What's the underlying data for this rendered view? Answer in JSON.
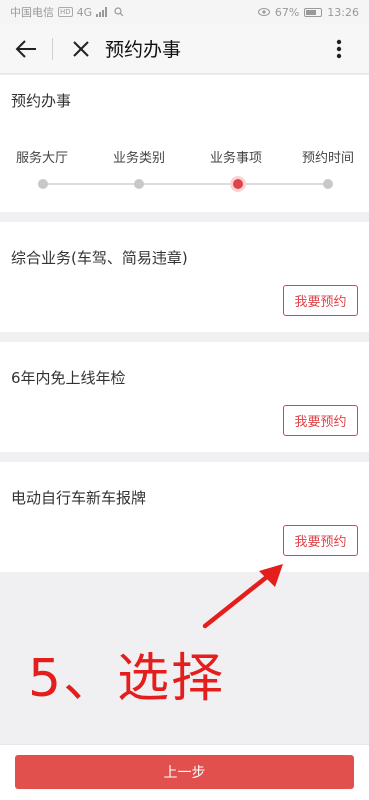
{
  "status_bar": {
    "carrier": "中国电信",
    "hd": "HD",
    "network": "4G",
    "battery": "67%",
    "time": "13:26"
  },
  "nav": {
    "title": "预约办事"
  },
  "steps": {
    "title": "预约办事",
    "items": [
      "服务大厅",
      "业务类别",
      "业务事项",
      "预约时间"
    ],
    "active_index": 2
  },
  "items": [
    {
      "title": "综合业务(车驾、简易违章)",
      "button": "我要预约"
    },
    {
      "title": "6年内免上线年检",
      "button": "我要预约"
    },
    {
      "title": "电动自行车新车报牌",
      "button": "我要预约"
    }
  ],
  "annotation": "5、选择",
  "footer": {
    "prev_label": "上一步"
  },
  "colors": {
    "accent": "#e0444a",
    "button": "#e2504d",
    "annotation": "#e41d1d"
  }
}
